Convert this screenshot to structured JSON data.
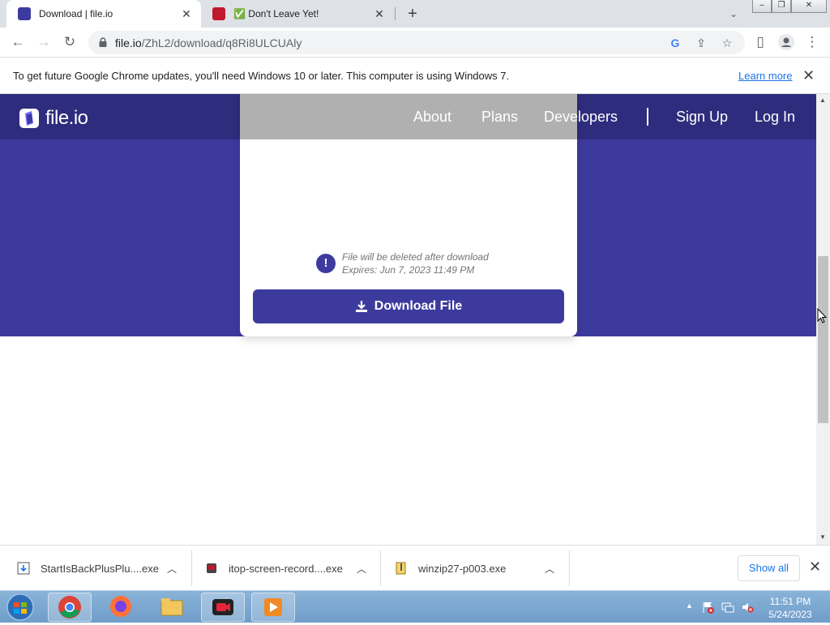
{
  "browser": {
    "tabs": [
      {
        "title": "Download | file.io",
        "active": true
      },
      {
        "title": "✅ Don't Leave Yet!",
        "active": false
      }
    ],
    "url_host": "file.io",
    "url_path": "/ZhL2/download/q8Ri8ULCUAly",
    "infobar": {
      "message": "To get future Google Chrome updates, you'll need Windows 10 or later. This computer is using Windows 7.",
      "link": "Learn more"
    }
  },
  "site": {
    "logo": "file.io",
    "nav": [
      "About",
      "Plans",
      "Developers",
      "Sign Up",
      "Log In"
    ],
    "notice_line1": "File will be deleted after download",
    "notice_line2": "Expires: Jun 7, 2023 11:49 PM",
    "download_button": "Download File",
    "brand_color": "#3d3a9e"
  },
  "downloads": {
    "items": [
      {
        "name": "StartIsBackPlusPlu....exe",
        "icon": "installer-icon"
      },
      {
        "name": "itop-screen-record....exe",
        "icon": "itop-app-icon"
      },
      {
        "name": "winzip27-p003.exe",
        "icon": "winzip-icon"
      }
    ],
    "show_all": "Show all"
  },
  "taskbar": {
    "time": "11:51 PM",
    "date": "5/24/2023",
    "apps": [
      "chrome-icon",
      "firefox-icon",
      "explorer-icon",
      "screen-recorder-icon",
      "media-player-icon"
    ]
  }
}
